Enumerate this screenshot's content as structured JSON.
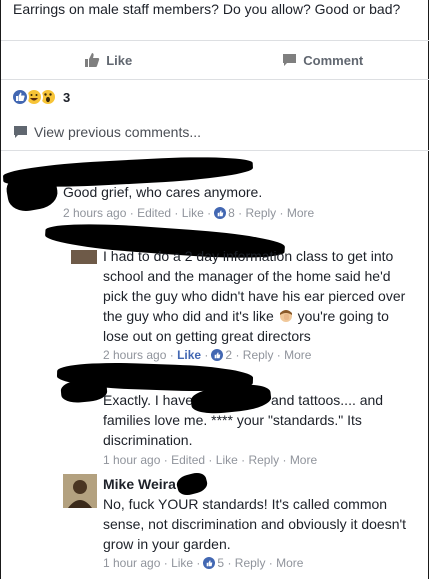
{
  "post": {
    "text": "Earrings on male staff members? Do you allow? Good or bad?"
  },
  "actions": {
    "like_label": "Like",
    "comment_label": "Comment"
  },
  "reactions": {
    "count": "3",
    "icons": [
      "like-icon",
      "haha-icon",
      "wow-icon"
    ]
  },
  "view_previous": "View previous comments...",
  "comments": [
    {
      "text": "Good grief, who cares anymore.",
      "time": "2 hours ago",
      "edited": "Edited",
      "like": "Like",
      "reactions": "8",
      "reply": "Reply",
      "more": "More"
    },
    {
      "text1": "I had to do a 2 day information class to get into",
      "text2": "school and the manager of the home said he'd",
      "text3": "pick the guy who didn't have his ear pierced over",
      "text4a": "the guy who did and it's like",
      "text4b": "you're going to",
      "text5": "lose out on getting great directors",
      "time": "2 hours ago",
      "like": "Like",
      "reactions": "2",
      "reply": "Reply",
      "more": "More"
    },
    {
      "text1a": "Exactly. I have",
      "text1b": "and tattoos.... and",
      "text2": "families love me. **** your \"standards.\" Its",
      "text3": "discrimination.",
      "time": "1 hour ago",
      "edited": "Edited",
      "like": "Like",
      "reply": "Reply",
      "more": "More"
    },
    {
      "name": "Mike Weira",
      "text1": "No, fuck YOUR standards! It's called common",
      "text2": "sense, not discrimination and obviously it doesn't",
      "text3": "grow in your garden.",
      "time": "1 hour ago",
      "like": "Like",
      "reactions": "5",
      "reply": "Reply",
      "more": "More"
    }
  ],
  "colors": {
    "fb_blue": "#4267b2",
    "meta_gray": "#90949c"
  }
}
